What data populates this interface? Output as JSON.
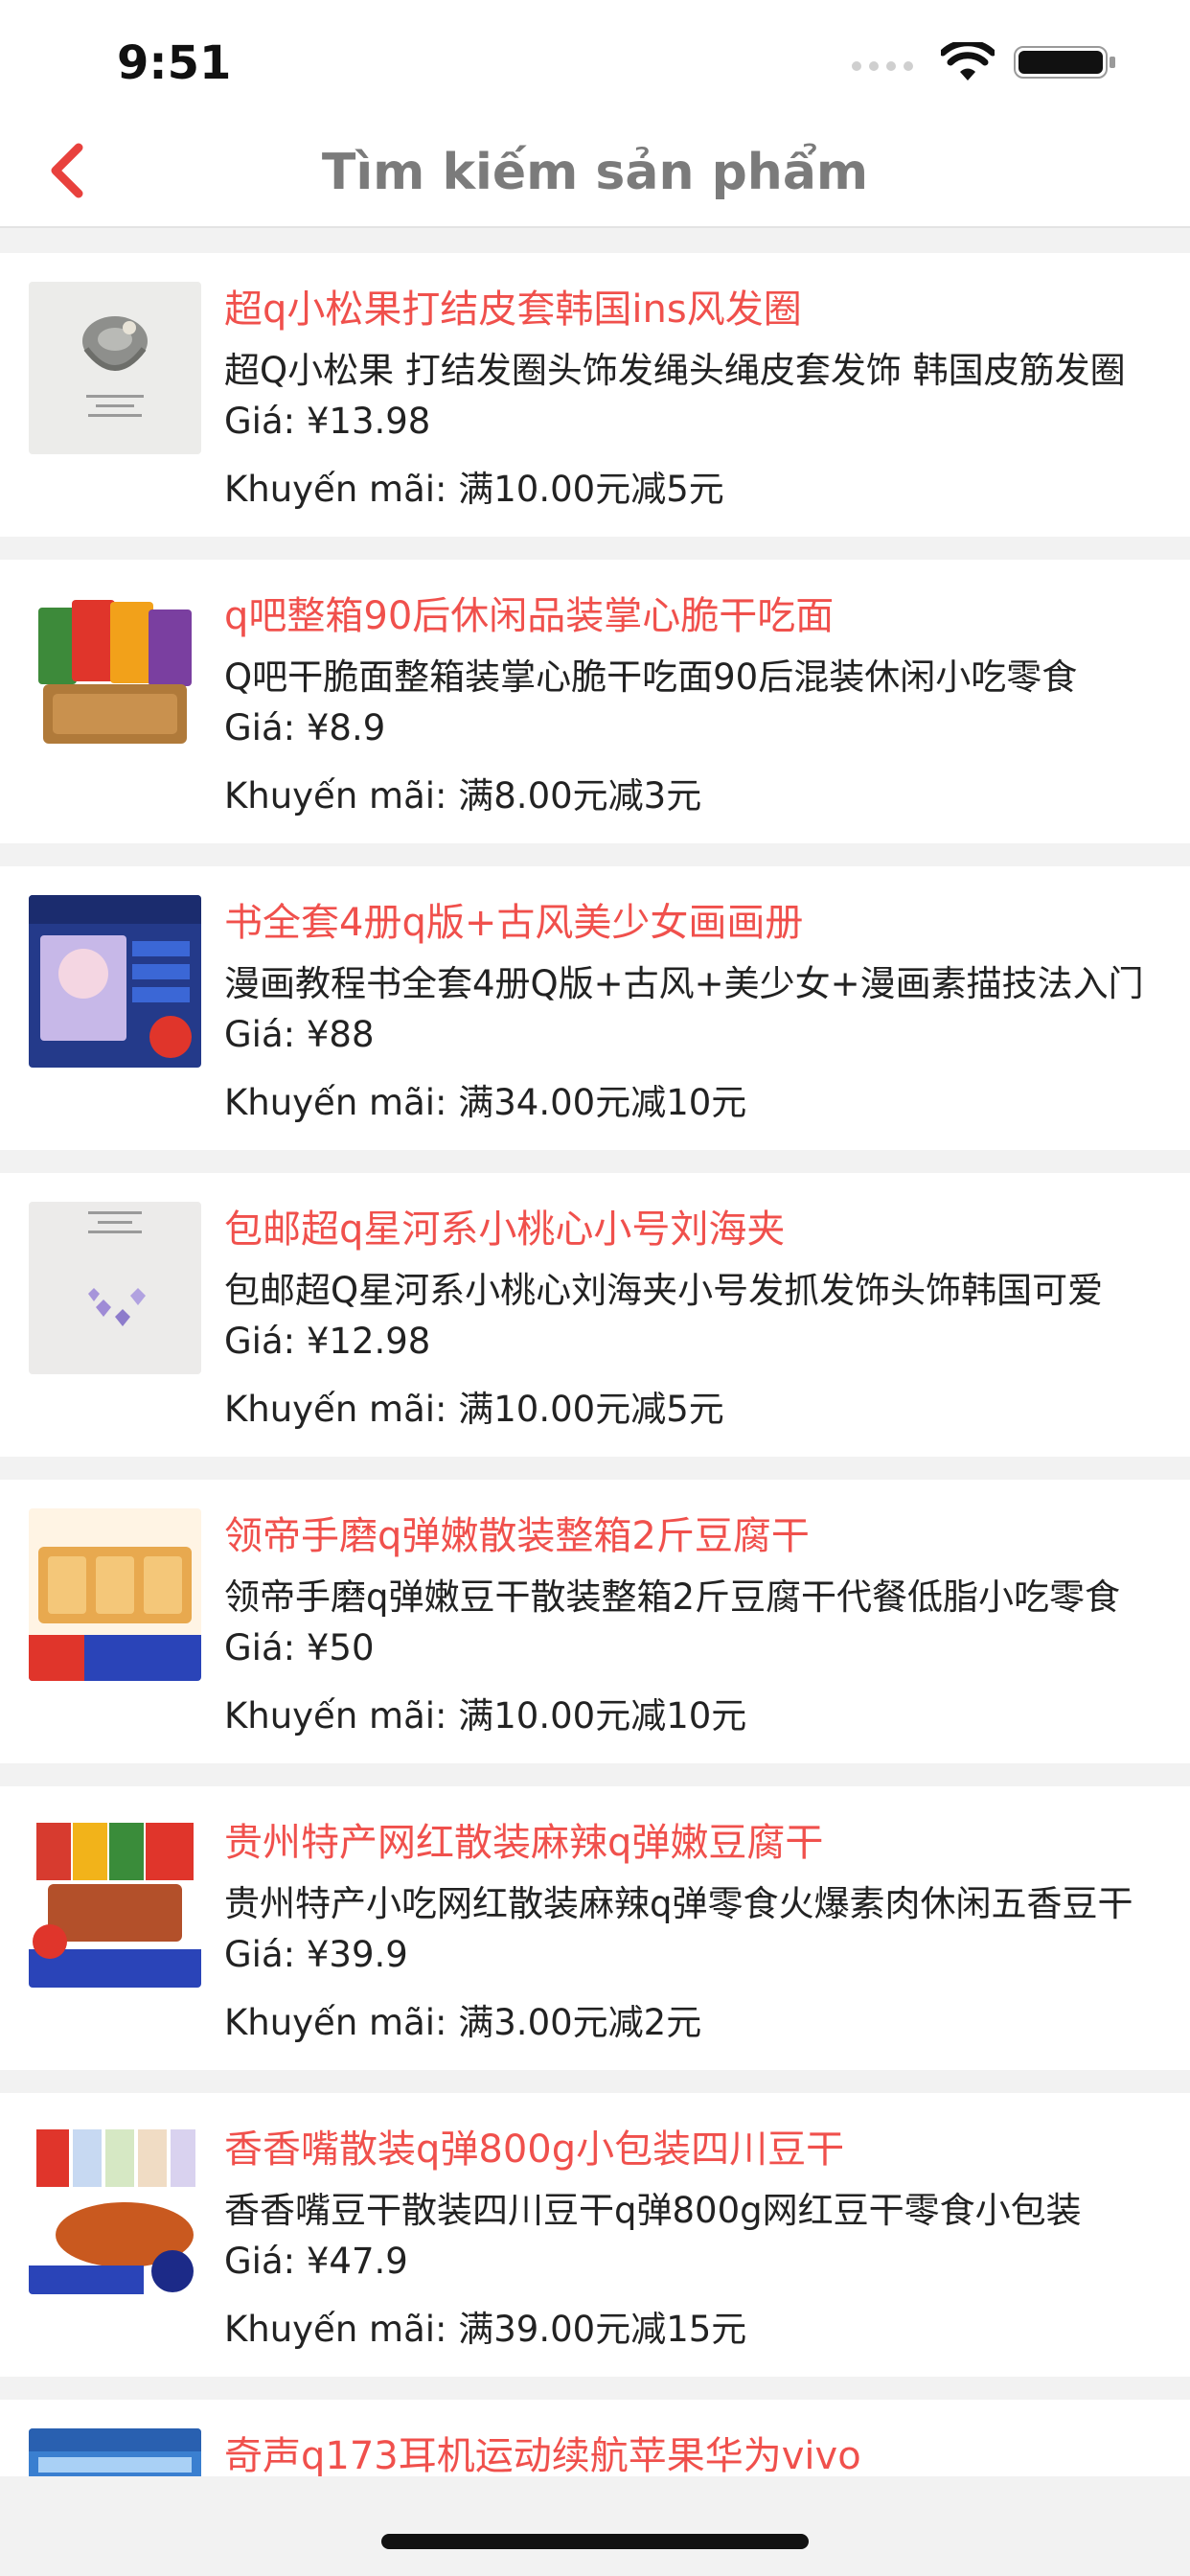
{
  "status": {
    "time": "9:51"
  },
  "header": {
    "title": "Tìm kiếm sản phẩm"
  },
  "labels": {
    "price_prefix": "Giá: ",
    "promo_prefix": "Khuyến mãi: "
  },
  "colors": {
    "accent": "#f0504c",
    "background": "#f2f2f2"
  },
  "products": [
    {
      "title": "超q小松果打结皮套韩国ins风发圈",
      "desc": "超Q小松果 打结发圈头饰发绳头绳皮套发饰 韩国皮筋发圈",
      "price": "¥13.98",
      "promo": "满10.00元减5元",
      "thumb": "hair-tie-gray"
    },
    {
      "title": "q吧整箱90后休闲品装掌心脆干吃面",
      "desc": "Q吧干脆面整箱装掌心脆干吃面90后混装休闲小吃零食",
      "price": "¥8.9",
      "promo": "满8.00元减3元",
      "thumb": "snack-bags"
    },
    {
      "title": "书全套4册q版+古风美少女画画册",
      "desc": "漫画教程书全套4册Q版+古风+美少女+漫画素描技法入门",
      "price": "¥88",
      "promo": "满34.00元减10元",
      "thumb": "book-set"
    },
    {
      "title": "包邮超q星河系小桃心小号刘海夹",
      "desc": "包邮超Q星河系小桃心刘海夹小号发抓发饰头饰韩国可爱",
      "price": "¥12.98",
      "promo": "满10.00元减5元",
      "thumb": "heart-clips"
    },
    {
      "title": "领帝手磨q弹嫩散装整箱2斤豆腐干",
      "desc": "领帝手磨q弹嫩豆干散装整箱2斤豆腐干代餐低脂小吃零食",
      "price": "¥50",
      "promo": "满10.00元减10元",
      "thumb": "tofu-blocks"
    },
    {
      "title": "贵州特产网红散装麻辣q弹嫩豆腐干",
      "desc": "贵州特产小吃网红散装麻辣q弹零食火爆素肉休闲五香豆干",
      "price": "¥39.9",
      "promo": "满3.00元减2元",
      "thumb": "spicy-tofu"
    },
    {
      "title": "香香嘴散装q弹800g小包装四川豆干",
      "desc": "香香嘴豆干散装四川豆干q弹800g网红豆干零食小包装",
      "price": "¥47.9",
      "promo": "满39.00元减15元",
      "thumb": "packaged-tofu"
    },
    {
      "title": "奇声q173耳机运动续航苹果华为vivo",
      "desc": "",
      "price": "",
      "promo": "",
      "thumb": "earphones"
    }
  ]
}
